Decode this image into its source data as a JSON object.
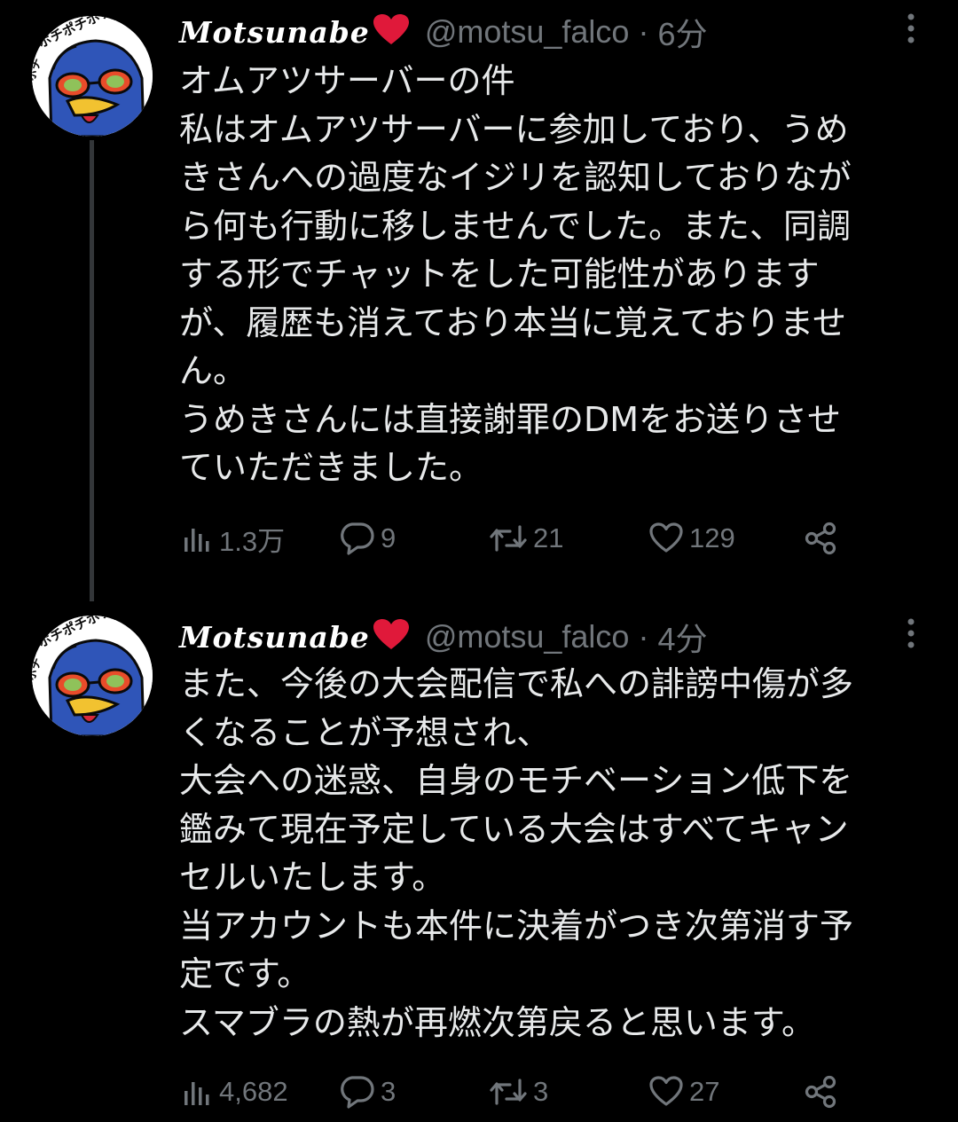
{
  "tweets": [
    {
      "display_name": "Motsunabe",
      "handle": "@motsu_falco",
      "separator": "·",
      "time": "6分",
      "body_lines": [
        "オムアツサーバーの件",
        "私はオムアツサーバーに参加しており、うめ",
        "きさんへの過度なイジリを認知しておりなが",
        "ら何も行動に移しませんでした。また、同調",
        "する形でチャットをした可能性があります",
        "が、履歴も消えており本当に覚えておりませ",
        "ん。",
        "うめきさんには直接謝罪のDMをお送りさせ",
        "ていただきました。"
      ],
      "views": "1.3万",
      "replies": "9",
      "retweets": "21",
      "likes": "129"
    },
    {
      "display_name": "Motsunabe",
      "handle": "@motsu_falco",
      "separator": "·",
      "time": "4分",
      "body_lines": [
        "また、今後の大会配信で私への誹謗中傷が多",
        "くなることが予想され、",
        "大会への迷惑、自身のモチベーション低下を",
        "鑑みて現在予定している大会はすべてキャン",
        "セルいたします。",
        "当アカウントも本件に決着がつき次第消す予",
        "定です。",
        "スマブラの熱が再燃次第戻ると思います。"
      ],
      "views": "4,682",
      "replies": "3",
      "retweets": "3",
      "likes": "27"
    }
  ],
  "icons": {
    "views": "bar-chart-icon",
    "reply": "speech-bubble-icon",
    "retweet": "retweet-arrows-icon",
    "like": "heart-outline-icon",
    "share": "share-nodes-icon",
    "more": "vertical-ellipsis-icon",
    "name_badge": "red-heart-emoji"
  },
  "colors": {
    "background": "#000000",
    "text": "#e7e9ea",
    "muted": "#71767b",
    "thread_line": "#333639",
    "heart": "#e0193a"
  }
}
